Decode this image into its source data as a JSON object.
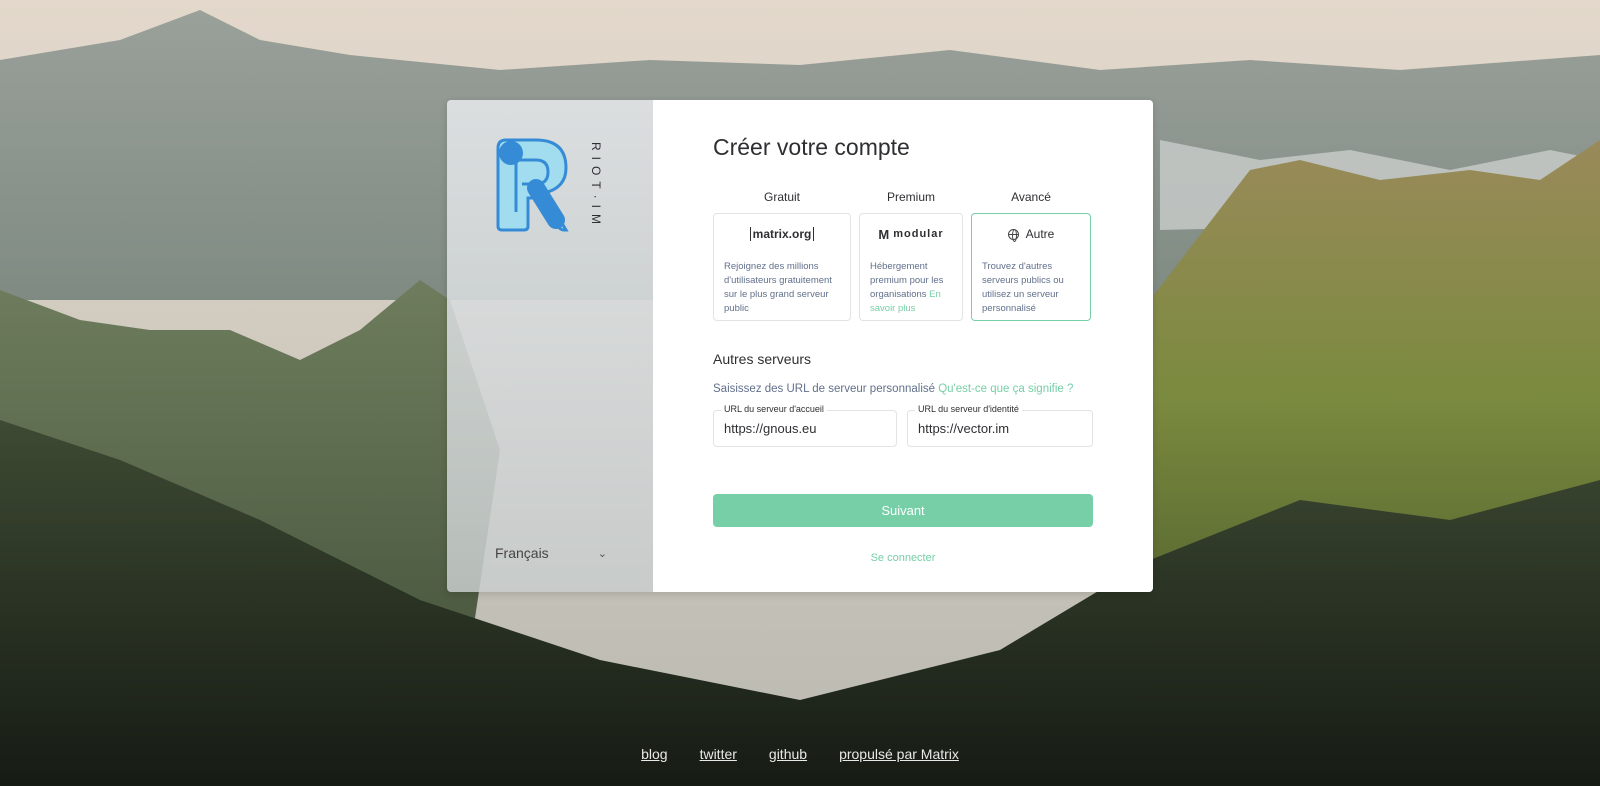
{
  "sidebar": {
    "brand_vertical": "RIOT·IM",
    "language": "Français"
  },
  "main": {
    "title": "Créer votre compte",
    "plans": [
      {
        "header": "Gratuit",
        "logo_text": "matrix.org",
        "description": "Rejoignez des millions d'utilisateurs gratuitement sur le plus grand serveur public"
      },
      {
        "header": "Premium",
        "logo_text": "modular",
        "logo_mark": "M",
        "description": "Hébergement premium pour les organisations",
        "link": "En savoir plus"
      },
      {
        "header": "Avancé",
        "logo_text": "Autre",
        "description": "Trouvez d'autres serveurs publics ou utilisez un serveur personnalisé",
        "selected": true
      }
    ],
    "section_title": "Autres serveurs",
    "hint_text": "Saisissez des URL de serveur personnalisé",
    "hint_link": "Qu'est-ce que ça signifie ?",
    "homeserver_label": "URL du serveur d'accueil",
    "homeserver_value": "https://gnous.eu",
    "identity_label": "URL du serveur d'identité",
    "identity_value": "https://vector.im",
    "next_button": "Suivant",
    "signin_link": "Se connecter"
  },
  "footer": {
    "links": [
      "blog",
      "twitter",
      "github",
      "propulsé par Matrix"
    ]
  },
  "colors": {
    "accent": "#76cfa6",
    "logo_blue": "#368bd6",
    "logo_light": "#a2ddef"
  }
}
